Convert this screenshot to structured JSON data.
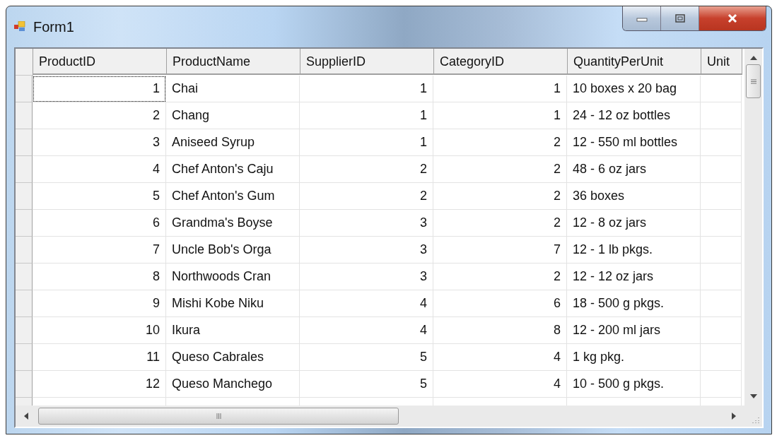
{
  "window": {
    "title": "Form1"
  },
  "table": {
    "columns": [
      "ProductID",
      "ProductName",
      "SupplierID",
      "CategoryID",
      "QuantityPerUnit",
      "Unit"
    ],
    "rows": [
      {
        "cells": [
          "1",
          "Chai",
          "1",
          "1",
          "10 boxes x 20 bag"
        ],
        "focused": true
      },
      {
        "cells": [
          "2",
          "Chang",
          "1",
          "1",
          "24 - 12 oz bottles"
        ],
        "focused": false
      },
      {
        "cells": [
          "3",
          "Aniseed Syrup",
          "1",
          "2",
          "12 - 550 ml bottles"
        ],
        "focused": false
      },
      {
        "cells": [
          "4",
          "Chef Anton's Caju",
          "2",
          "2",
          "48 - 6 oz jars"
        ],
        "focused": false
      },
      {
        "cells": [
          "5",
          "Chef Anton's Gum",
          "2",
          "2",
          "36 boxes"
        ],
        "focused": false
      },
      {
        "cells": [
          "6",
          "Grandma's Boyse",
          "3",
          "2",
          "12 - 8 oz jars"
        ],
        "focused": false
      },
      {
        "cells": [
          "7",
          "Uncle Bob's Orga",
          "3",
          "7",
          "12 - 1 lb pkgs."
        ],
        "focused": false
      },
      {
        "cells": [
          "8",
          "Northwoods Cran",
          "3",
          "2",
          "12 - 12 oz jars"
        ],
        "focused": false
      },
      {
        "cells": [
          "9",
          "Mishi Kobe Niku",
          "4",
          "6",
          "18 - 500 g pkgs."
        ],
        "focused": false
      },
      {
        "cells": [
          "10",
          "Ikura",
          "4",
          "8",
          "12 - 200 ml jars"
        ],
        "focused": false
      },
      {
        "cells": [
          "11",
          "Queso Cabrales",
          "5",
          "4",
          "1 kg pkg."
        ],
        "focused": false
      },
      {
        "cells": [
          "12",
          "Queso Manchego",
          "5",
          "4",
          "10 - 500 g pkgs."
        ],
        "focused": false
      }
    ]
  }
}
